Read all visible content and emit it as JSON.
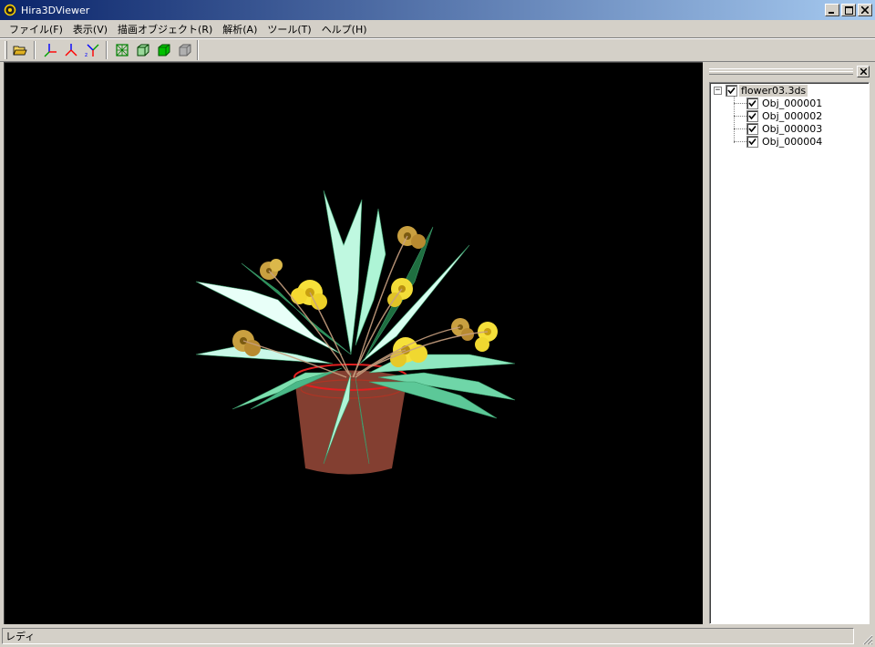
{
  "window": {
    "title": "Hira3DViewer",
    "minimize_label": "_",
    "maximize_label": "□",
    "close_label": "×"
  },
  "menu": {
    "items": [
      {
        "label": "ファイル(F)"
      },
      {
        "label": "表示(V)"
      },
      {
        "label": "描画オブジェクト(R)"
      },
      {
        "label": "解析(A)"
      },
      {
        "label": "ツール(T)"
      },
      {
        "label": "ヘルプ(H)"
      }
    ]
  },
  "toolbar": {
    "buttons": [
      {
        "icon": "open-folder-icon"
      },
      {
        "icon": "axis-xyz-icon"
      },
      {
        "icon": "axis-yz-icon"
      },
      {
        "icon": "axis-zx-icon"
      },
      {
        "icon": "wireframe-icon"
      },
      {
        "icon": "box-outline-icon"
      },
      {
        "icon": "solid-cube-icon"
      },
      {
        "icon": "gray-cube-icon"
      }
    ]
  },
  "side_panel": {
    "close_label": "×",
    "tree": {
      "root": {
        "label": "flower03.3ds",
        "checked": true,
        "expanded": true,
        "expander": "−"
      },
      "children": [
        {
          "label": "Obj_000001",
          "checked": true
        },
        {
          "label": "Obj_000002",
          "checked": true
        },
        {
          "label": "Obj_000003",
          "checked": true
        },
        {
          "label": "Obj_000004",
          "checked": true
        }
      ]
    }
  },
  "statusbar": {
    "text": "レディ"
  },
  "colors": {
    "titlebar_start": "#0a246a",
    "titlebar_end": "#a6caf0",
    "chrome": "#d4d0c8",
    "viewport_bg": "#000000"
  }
}
